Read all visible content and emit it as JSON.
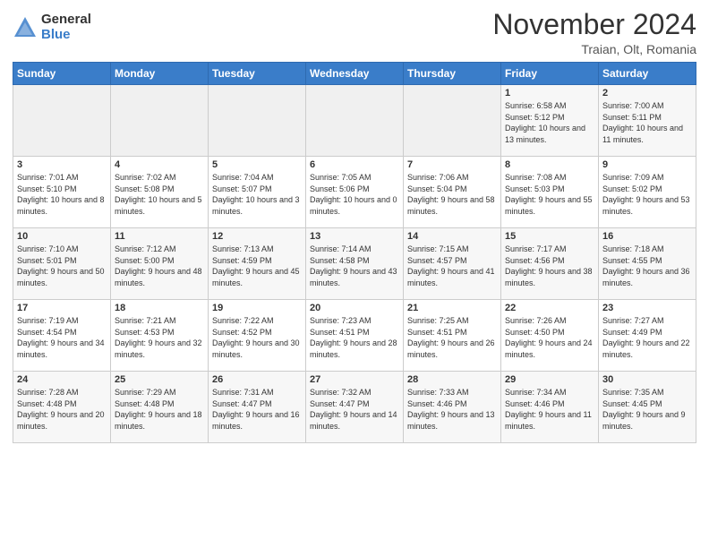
{
  "header": {
    "logo_general": "General",
    "logo_blue": "Blue",
    "month_title": "November 2024",
    "location": "Traian, Olt, Romania"
  },
  "days_of_week": [
    "Sunday",
    "Monday",
    "Tuesday",
    "Wednesday",
    "Thursday",
    "Friday",
    "Saturday"
  ],
  "weeks": [
    [
      {
        "day": "",
        "empty": true
      },
      {
        "day": "",
        "empty": true
      },
      {
        "day": "",
        "empty": true
      },
      {
        "day": "",
        "empty": true
      },
      {
        "day": "",
        "empty": true
      },
      {
        "day": "1",
        "sunrise": "6:58 AM",
        "sunset": "5:12 PM",
        "daylight": "10 hours and 13 minutes."
      },
      {
        "day": "2",
        "sunrise": "7:00 AM",
        "sunset": "5:11 PM",
        "daylight": "10 hours and 11 minutes."
      }
    ],
    [
      {
        "day": "3",
        "sunrise": "7:01 AM",
        "sunset": "5:10 PM",
        "daylight": "10 hours and 8 minutes."
      },
      {
        "day": "4",
        "sunrise": "7:02 AM",
        "sunset": "5:08 PM",
        "daylight": "10 hours and 5 minutes."
      },
      {
        "day": "5",
        "sunrise": "7:04 AM",
        "sunset": "5:07 PM",
        "daylight": "10 hours and 3 minutes."
      },
      {
        "day": "6",
        "sunrise": "7:05 AM",
        "sunset": "5:06 PM",
        "daylight": "10 hours and 0 minutes."
      },
      {
        "day": "7",
        "sunrise": "7:06 AM",
        "sunset": "5:04 PM",
        "daylight": "9 hours and 58 minutes."
      },
      {
        "day": "8",
        "sunrise": "7:08 AM",
        "sunset": "5:03 PM",
        "daylight": "9 hours and 55 minutes."
      },
      {
        "day": "9",
        "sunrise": "7:09 AM",
        "sunset": "5:02 PM",
        "daylight": "9 hours and 53 minutes."
      }
    ],
    [
      {
        "day": "10",
        "sunrise": "7:10 AM",
        "sunset": "5:01 PM",
        "daylight": "9 hours and 50 minutes."
      },
      {
        "day": "11",
        "sunrise": "7:12 AM",
        "sunset": "5:00 PM",
        "daylight": "9 hours and 48 minutes."
      },
      {
        "day": "12",
        "sunrise": "7:13 AM",
        "sunset": "4:59 PM",
        "daylight": "9 hours and 45 minutes."
      },
      {
        "day": "13",
        "sunrise": "7:14 AM",
        "sunset": "4:58 PM",
        "daylight": "9 hours and 43 minutes."
      },
      {
        "day": "14",
        "sunrise": "7:15 AM",
        "sunset": "4:57 PM",
        "daylight": "9 hours and 41 minutes."
      },
      {
        "day": "15",
        "sunrise": "7:17 AM",
        "sunset": "4:56 PM",
        "daylight": "9 hours and 38 minutes."
      },
      {
        "day": "16",
        "sunrise": "7:18 AM",
        "sunset": "4:55 PM",
        "daylight": "9 hours and 36 minutes."
      }
    ],
    [
      {
        "day": "17",
        "sunrise": "7:19 AM",
        "sunset": "4:54 PM",
        "daylight": "9 hours and 34 minutes."
      },
      {
        "day": "18",
        "sunrise": "7:21 AM",
        "sunset": "4:53 PM",
        "daylight": "9 hours and 32 minutes."
      },
      {
        "day": "19",
        "sunrise": "7:22 AM",
        "sunset": "4:52 PM",
        "daylight": "9 hours and 30 minutes."
      },
      {
        "day": "20",
        "sunrise": "7:23 AM",
        "sunset": "4:51 PM",
        "daylight": "9 hours and 28 minutes."
      },
      {
        "day": "21",
        "sunrise": "7:25 AM",
        "sunset": "4:51 PM",
        "daylight": "9 hours and 26 minutes."
      },
      {
        "day": "22",
        "sunrise": "7:26 AM",
        "sunset": "4:50 PM",
        "daylight": "9 hours and 24 minutes."
      },
      {
        "day": "23",
        "sunrise": "7:27 AM",
        "sunset": "4:49 PM",
        "daylight": "9 hours and 22 minutes."
      }
    ],
    [
      {
        "day": "24",
        "sunrise": "7:28 AM",
        "sunset": "4:48 PM",
        "daylight": "9 hours and 20 minutes."
      },
      {
        "day": "25",
        "sunrise": "7:29 AM",
        "sunset": "4:48 PM",
        "daylight": "9 hours and 18 minutes."
      },
      {
        "day": "26",
        "sunrise": "7:31 AM",
        "sunset": "4:47 PM",
        "daylight": "9 hours and 16 minutes."
      },
      {
        "day": "27",
        "sunrise": "7:32 AM",
        "sunset": "4:47 PM",
        "daylight": "9 hours and 14 minutes."
      },
      {
        "day": "28",
        "sunrise": "7:33 AM",
        "sunset": "4:46 PM",
        "daylight": "9 hours and 13 minutes."
      },
      {
        "day": "29",
        "sunrise": "7:34 AM",
        "sunset": "4:46 PM",
        "daylight": "9 hours and 11 minutes."
      },
      {
        "day": "30",
        "sunrise": "7:35 AM",
        "sunset": "4:45 PM",
        "daylight": "9 hours and 9 minutes."
      }
    ]
  ]
}
